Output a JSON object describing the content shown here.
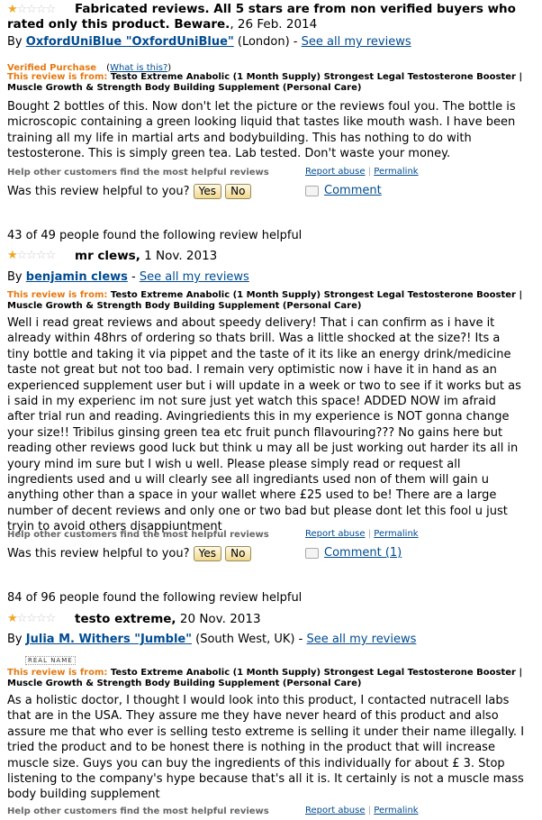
{
  "reviews": [
    {
      "rating": 1,
      "title": "Fabricated reviews. All 5 stars are from non verified buyers who rated only this product. Beware.",
      "title_line1": "Fabricated reviews. All 5 stars are from non verified buyers who",
      "title_line2": "rated only this product. Beware.",
      "date": ", 26 Feb. 2014",
      "by": "By",
      "author": "OxfordUniBlue \"OxfordUniBlue\"",
      "location": "(London) -",
      "see_all": "See all my reviews",
      "verified": "Verified Purchase",
      "what_is_this": "What is this?",
      "review_from_label": "This review is from:",
      "product_line1": "Testo Extreme Anabolic (1 Month Supply) Strongest Legal Testosterone Booster |",
      "product_line2": "Muscle Growth & Strength Body Building Supplement (Personal Care)",
      "body_lines": [
        "Bought 2 bottles of this. Now don't let the picture or the reviews foul you. The bottle is",
        "microscopic containing a green looking liquid that tastes like mouth wash. I have been",
        "training all my life in martial arts and bodybuilding. This has nothing to do with",
        "testosterone. This is simply green tea. Lab tested. Don't waste your money."
      ],
      "help_text": "Help other customers find the most helpful reviews",
      "report": "Report abuse",
      "permalink": "Permalink",
      "was_helpful": "Was this review helpful to you?",
      "yes": "Yes",
      "no": "No",
      "comment": "Comment"
    },
    {
      "helpful_count": "43 of 49 people found the following review helpful",
      "rating": 1,
      "title": "mr clews,",
      "date": " 1 Nov. 2013",
      "by": "By",
      "author": "benjamin clews",
      "location": "-",
      "see_all": "See all my reviews",
      "review_from_label": "This review is from:",
      "product_line1": "Testo Extreme Anabolic (1 Month Supply) Strongest Legal Testosterone Booster |",
      "product_line2": "Muscle Growth & Strength Body Building Supplement (Personal Care)",
      "body_lines": [
        "Well i read great reviews and about speedy delivery! That i can confirm as i have it",
        "already within 48hrs of ordering so thats brill. Was a little shocked at the size?! Its a",
        "tiny bottle and taking it via pippet and the taste of it its like an energy drink/medicine",
        "taste not great but not too bad. I remain very optimistic now i have it in hand as an",
        "experienced supplement user but i will update in a week or two to see if it works but as",
        "i said in my experienc im not sure just yet watch this space! ADDED NOW im afraid",
        "after trial run and reading. Avingriedients this in my experience is NOT gonna change",
        "your size!! Tribilus ginsing green tea etc fruit punch fllavouring??? No gains here but",
        "reading other reviews good luck but think u may all be just working out harder its all in",
        "youry mind im sure but I wish u well. Please please simply read or request all",
        "ingredients used and u will clearly see all ingrediants used non of them will gain u",
        "anything other than a space in your wallet where £25 used to be! There are a large",
        "number of decent reviews and only one or two bad but please dont let this fool u just",
        "tryin to avoid others disappiuntment"
      ],
      "help_text": "Help other customers find the most helpful reviews",
      "report": "Report abuse",
      "permalink": "Permalink",
      "was_helpful": "Was this review helpful to you?",
      "yes": "Yes",
      "no": "No",
      "comment": "Comment (1)"
    },
    {
      "helpful_count": "84 of 96 people found the following review helpful",
      "rating": 1,
      "title": "testo extreme,",
      "date": " 20 Nov. 2013",
      "by": "By",
      "author": "Julia M. Withers \"Jumble\"",
      "location": "(South West, UK) -",
      "see_all": "See all my reviews",
      "real_name": "REAL NAME",
      "review_from_label": "This review is from:",
      "product_line1": "Testo Extreme Anabolic (1 Month Supply) Strongest Legal Testosterone Booster |",
      "product_line2": "Muscle Growth & Strength Body Building Supplement (Personal Care)",
      "body_lines": [
        "As a holistic doctor, I thought I would look into this product, I contacted nutracell labs",
        "that are in the USA. They assure me they have never heard of this product and also",
        "assure me that who ever is selling testo extreme is selling it under their name illegally. I",
        "tried the product and to be honest there is nothing in the product that will increase",
        "muscle size. Guys you can buy the ingredients of this individually for about £ 3. Stop",
        "listening to the company's hype because that's all it is. It certainly is not a muscle mass",
        "body building supplement"
      ],
      "help_text": "Help other customers find the most helpful reviews",
      "report": "Report abuse",
      "permalink": "Permalink"
    }
  ]
}
